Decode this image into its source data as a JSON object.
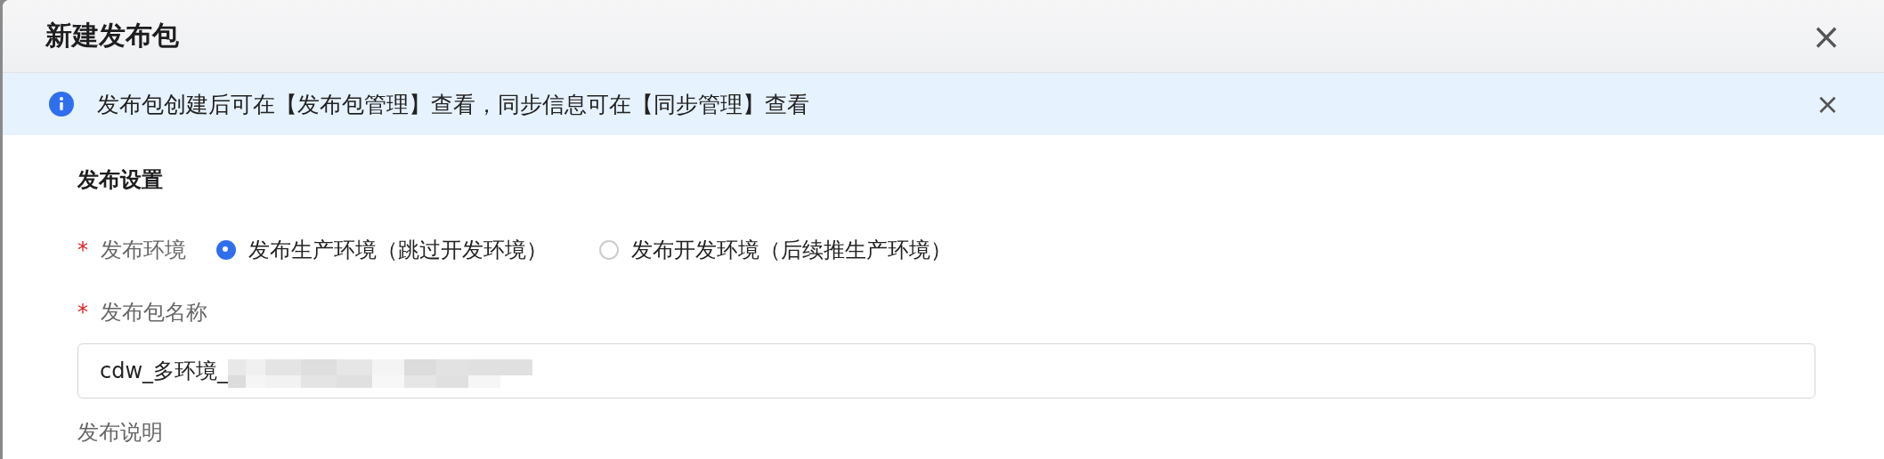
{
  "dialog": {
    "title": "新建发布包",
    "close_icon": "×"
  },
  "alert": {
    "text": "发布包创建后可在【发布包管理】查看，同步信息可在【同步管理】查看",
    "close_icon": "×"
  },
  "section": {
    "title": "发布设置"
  },
  "fields": [
    {
      "kind": "radio",
      "label": "发布环境",
      "required_mark": "*",
      "options": [
        {
          "label": "发布生产环境（跳过开发环境）",
          "selected": true
        },
        {
          "label": "发布开发环境（后续推生产环境）",
          "selected": false
        }
      ]
    },
    {
      "kind": "input",
      "label": "发布包名称",
      "required_mark": "*",
      "value": "cdw_多环境_"
    },
    {
      "kind": "label",
      "label": "发布说明"
    }
  ]
}
